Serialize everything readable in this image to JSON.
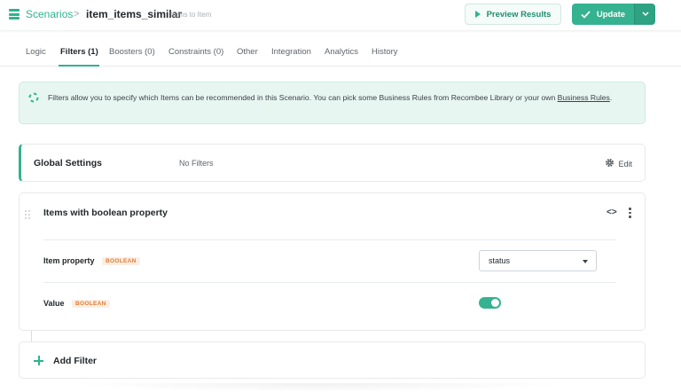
{
  "header": {
    "breadcrumb_root": "Scenarios",
    "breadcrumb_sep": ">",
    "scenario_name": "item_items_similar",
    "scenario_type": "Items to Item",
    "preview_label": "Preview Results",
    "update_label": "Update"
  },
  "tabs": [
    {
      "label": "Logic"
    },
    {
      "label": "Filters (1)",
      "active": true
    },
    {
      "label": "Boosters (0)"
    },
    {
      "label": "Constraints (0)"
    },
    {
      "label": "Other"
    },
    {
      "label": "Integration"
    },
    {
      "label": "Analytics"
    },
    {
      "label": "History"
    }
  ],
  "info": {
    "text": "Filters allow you to specify which Items can be recommended in this Scenario. You can pick some Business Rules from Recombee Library or your own ",
    "link": "Business Rules",
    "end": "."
  },
  "global_settings": {
    "title": "Global Settings",
    "value": "No Filters",
    "edit_label": "Edit"
  },
  "filter": {
    "title": "Items with boolean property",
    "code_label": "<>",
    "rows": [
      {
        "label": "Item property",
        "badge": "BOOLEAN",
        "value": "status"
      },
      {
        "label": "Value",
        "badge": "BOOLEAN",
        "enabled": true
      }
    ]
  },
  "add_filter": {
    "label": "Add Filter"
  },
  "colors": {
    "accent": "#35b28f",
    "badge": "#e07b36"
  }
}
